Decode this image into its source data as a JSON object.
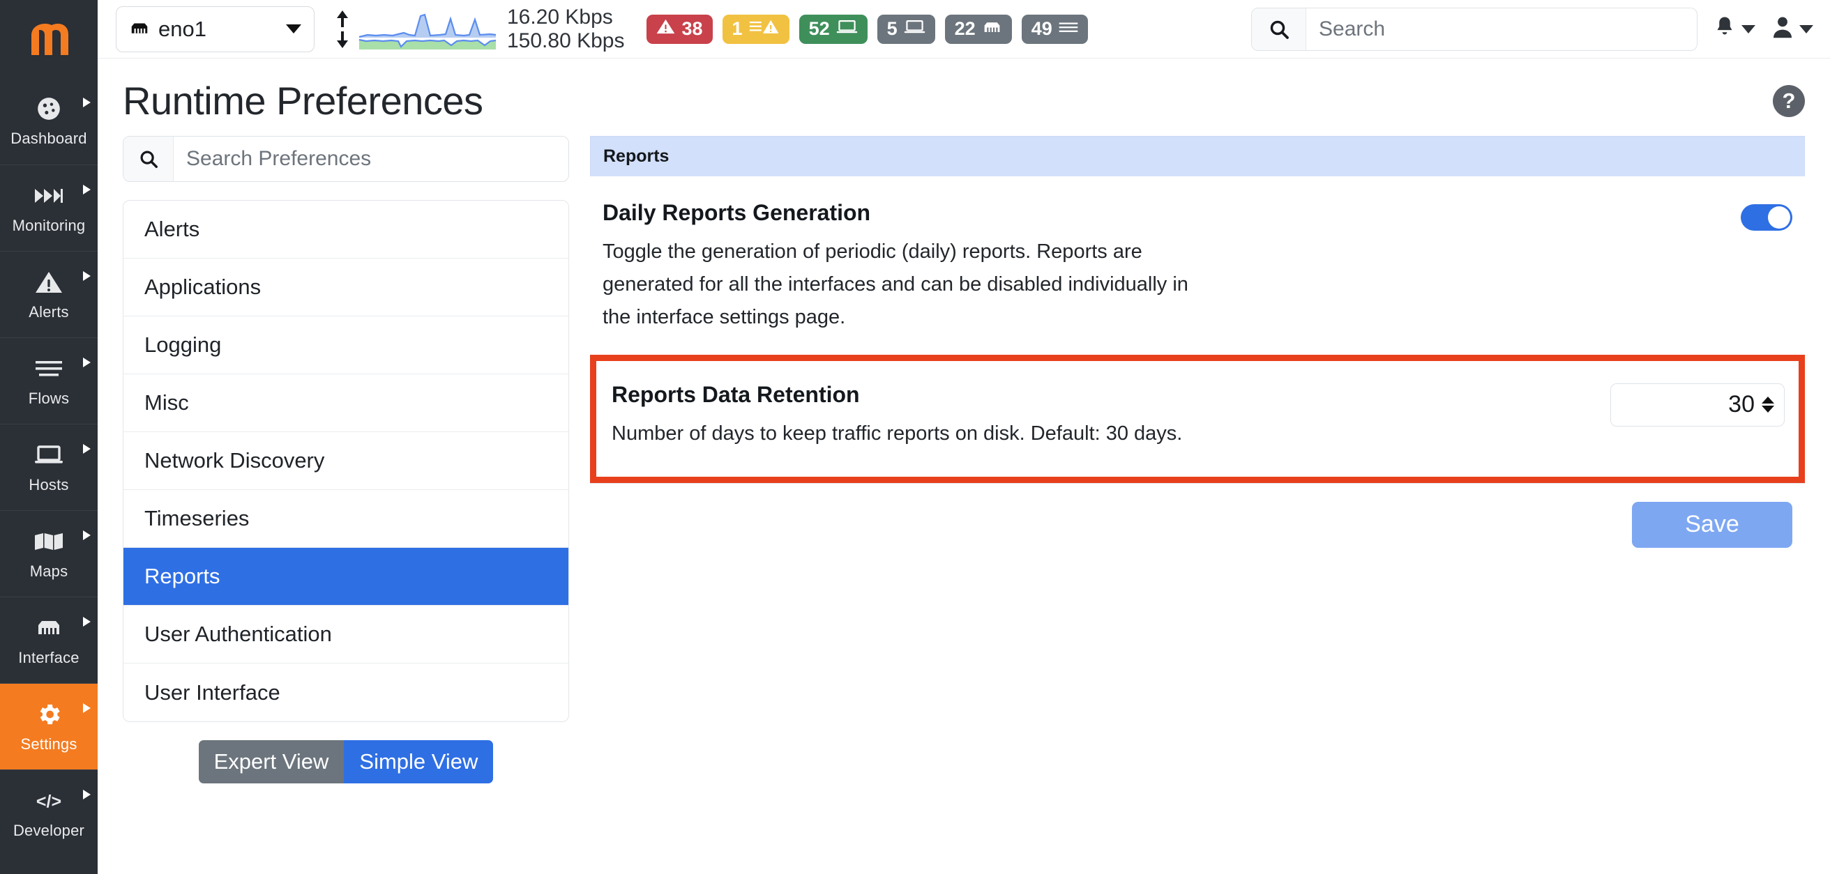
{
  "sidebar": {
    "logo": "ntopng-logo",
    "items": [
      {
        "label": "Dashboard",
        "icon": "dashboard-icon",
        "active": false
      },
      {
        "label": "Monitoring",
        "icon": "monitoring-icon",
        "active": false
      },
      {
        "label": "Alerts",
        "icon": "alerts-icon",
        "active": false
      },
      {
        "label": "Flows",
        "icon": "flows-icon",
        "active": false
      },
      {
        "label": "Hosts",
        "icon": "hosts-icon",
        "active": false
      },
      {
        "label": "Maps",
        "icon": "maps-icon",
        "active": false
      },
      {
        "label": "Interface",
        "icon": "interface-icon",
        "active": false
      },
      {
        "label": "Settings",
        "icon": "gear-icon",
        "active": true
      },
      {
        "label": "Developer",
        "icon": "code-icon",
        "active": false
      }
    ],
    "active_color": "#f47b20",
    "background": "#2b2f36"
  },
  "topbar": {
    "interface_selector": {
      "value": "eno1",
      "icon": "ethernet-icon",
      "caret": "chevron-down-icon"
    },
    "traffic": {
      "updown_icon": "up-down-arrows-icon",
      "upload_rate": "16.20 Kbps",
      "download_rate": "150.80 Kbps",
      "sparkline_up_color": "#a8c4f0",
      "sparkline_down_color": "#a9dfa9",
      "sparkline_line_color": "#5b8def"
    },
    "badges": [
      {
        "count": "38",
        "icon": "warning-triangle-icon",
        "color": "#c8414b",
        "icon_side": "left"
      },
      {
        "count": "1",
        "icon": "list-warning-icon",
        "color": "#f1c142",
        "icon_side": "right"
      },
      {
        "count": "52",
        "icon": "device-icon",
        "color": "#3f8f5b",
        "icon_side": "right"
      },
      {
        "count": "5",
        "icon": "device-icon",
        "color": "#6c757d",
        "icon_side": "right"
      },
      {
        "count": "22",
        "icon": "ethernet-icon",
        "color": "#6c757d",
        "icon_side": "right"
      },
      {
        "count": "49",
        "icon": "list-icon",
        "color": "#6c757d",
        "icon_side": "right"
      }
    ],
    "search": {
      "placeholder": "Search",
      "value": "",
      "icon": "search-icon"
    },
    "notifications": {
      "icon": "bell-icon",
      "caret": "chevron-down-icon"
    },
    "user": {
      "icon": "user-icon",
      "caret": "chevron-down-icon"
    }
  },
  "page": {
    "title": "Runtime Preferences",
    "help": {
      "icon": "question-mark-icon",
      "label": "?"
    }
  },
  "preferences": {
    "search": {
      "placeholder": "Search Preferences",
      "value": "",
      "icon": "search-icon"
    },
    "items": [
      {
        "label": "Alerts",
        "selected": false
      },
      {
        "label": "Applications",
        "selected": false
      },
      {
        "label": "Logging",
        "selected": false
      },
      {
        "label": "Misc",
        "selected": false
      },
      {
        "label": "Network Discovery",
        "selected": false
      },
      {
        "label": "Timeseries",
        "selected": false
      },
      {
        "label": "Reports",
        "selected": true
      },
      {
        "label": "User Authentication",
        "selected": false
      },
      {
        "label": "User Interface",
        "selected": false
      }
    ],
    "view_toggle": {
      "expert_label": "Expert View",
      "simple_label": "Simple View",
      "active": "Simple View"
    }
  },
  "content": {
    "section_header": "Reports",
    "settings": [
      {
        "title": "Daily Reports Generation",
        "description": "Toggle the generation of periodic (daily) reports. Reports are generated for all the interfaces and can be disabled individually in the interface settings page.",
        "control": "toggle",
        "toggle_on": true,
        "highlighted": false
      },
      {
        "title": "Reports Data Retention",
        "description": "Number of days to keep traffic reports on disk. Default: 30 days.",
        "control": "number",
        "value": "30",
        "highlighted": true,
        "highlight_color": "#e8401c"
      }
    ],
    "save_label": "Save",
    "save_color": "#7ea7f2"
  }
}
